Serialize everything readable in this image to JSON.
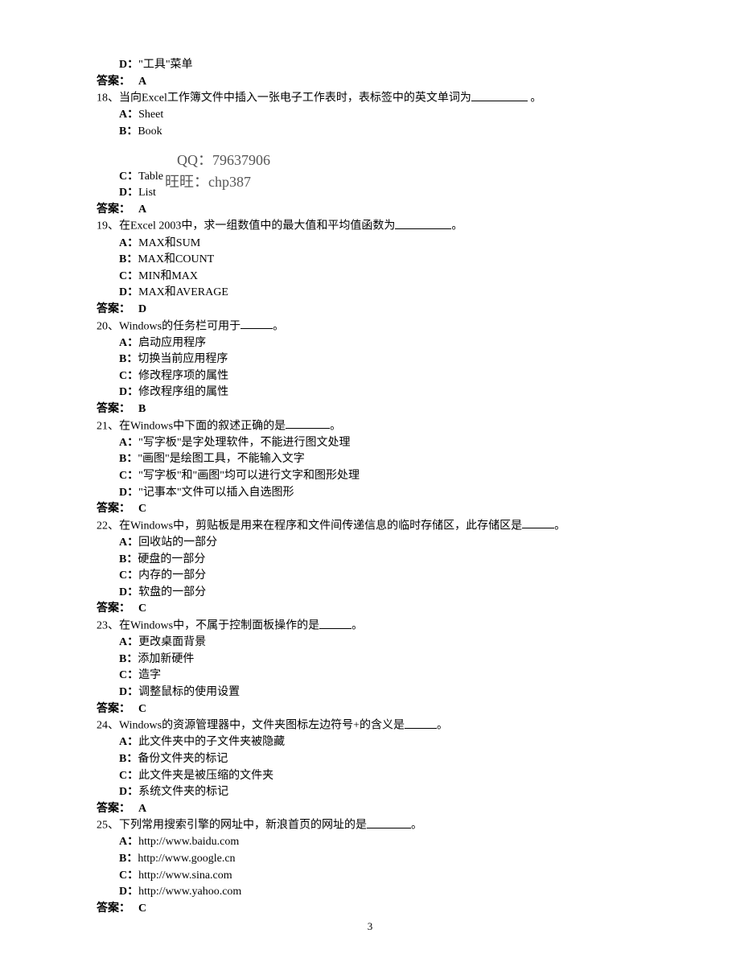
{
  "prior_option_D": "\"工具\"菜单",
  "prior_answer_label": "答案：",
  "prior_answer_value": "A",
  "watermark_qq_label": "QQ：",
  "watermark_qq_value": "79637906",
  "watermark_ww_label": "旺旺：",
  "watermark_ww_value": "chp387",
  "q18": {
    "num": "18、",
    "text_before": "当向Excel工作簿文件中插入一张电子工作表时，表标签中的英文单词为",
    "text_after": " 。",
    "A": "Sheet",
    "B": "Book",
    "C": "Table",
    "D": "List",
    "answer_label": "答案：",
    "answer_value": "A"
  },
  "q19": {
    "num": "19、",
    "text_before": "在Excel 2003中，求一组数值中的最大值和平均值函数为",
    "text_after": "。",
    "A": "MAX和SUM",
    "B": "MAX和COUNT",
    "C": "MIN和MAX",
    "D": "MAX和AVERAGE",
    "answer_label": "答案：",
    "answer_value": "D"
  },
  "q20": {
    "num": "20、",
    "text_before": "Windows的任务栏可用于",
    "text_after": "。",
    "A": "启动应用程序",
    "B": "切换当前应用程序",
    "C": "修改程序项的属性",
    "D": "修改程序组的属性",
    "answer_label": "答案：",
    "answer_value": "B"
  },
  "q21": {
    "num": "21、",
    "text_before": "在Windows中下面的叙述正确的是",
    "text_after": "。",
    "A": "\"写字板\"是字处理软件，不能进行图文处理",
    "B": "\"画图\"是绘图工具，不能输入文字",
    "C": "\"写字板\"和\"画图\"均可以进行文字和图形处理",
    "D": "\"记事本\"文件可以插入自选图形",
    "answer_label": "答案：",
    "answer_value": "C"
  },
  "q22": {
    "num": "22、",
    "text_before": "在Windows中，剪贴板是用来在程序和文件间传递信息的临时存储区，此存储区是",
    "text_after": "。",
    "A": "回收站的一部分",
    "B": "硬盘的一部分",
    "C": "内存的一部分",
    "D": "软盘的一部分",
    "answer_label": "答案：",
    "answer_value": "C"
  },
  "q23": {
    "num": "23、",
    "text_before": "在Windows中，不属于控制面板操作的是",
    "text_after": "。",
    "A": "更改桌面背景",
    "B": "添加新硬件",
    "C": "造字",
    "D": "调整鼠标的使用设置",
    "answer_label": "答案：",
    "answer_value": "C"
  },
  "q24": {
    "num": "24、",
    "text_before": "Windows的资源管理器中，文件夹图标左边符号+的含义是",
    "text_after": "。",
    "A": "此文件夹中的子文件夹被隐藏",
    "B": "备份文件夹的标记",
    "C": "此文件夹是被压缩的文件夹",
    "D": "系统文件夹的标记",
    "answer_label": "答案：",
    "answer_value": "A"
  },
  "q25": {
    "num": "25、",
    "text_before": "下列常用搜索引擎的网址中，新浪首页的网址的是",
    "text_after": "。",
    "A": "http://www.baidu.com",
    "B": "http://www.google.cn",
    "C": "http://www.sina.com",
    "D": "http://www.yahoo.com",
    "answer_label": "答案：",
    "answer_value": "C"
  },
  "page_number": "3",
  "opt_A": "A：",
  "opt_B": "B：",
  "opt_C": "C：",
  "opt_D": "D："
}
